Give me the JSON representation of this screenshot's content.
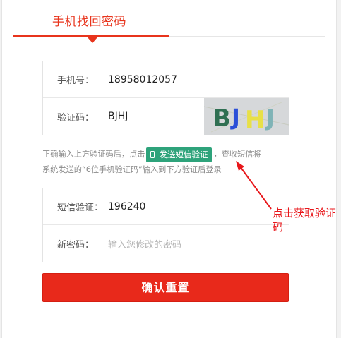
{
  "tab": {
    "title": "手机找回密码"
  },
  "phone": {
    "label": "手机号：",
    "value": "18958012057"
  },
  "captcha": {
    "label": "验证码：",
    "value": "BJHJ",
    "image_text": "BJHJ"
  },
  "hint": {
    "before": "正确输入上方验证码后，点击",
    "button": "发送短信验证",
    "after": "，查收短信将",
    "line2": "系统发送的“6位手机验证码”输入到下方验证后登录"
  },
  "sms": {
    "label": "短信验证：",
    "value": "196240"
  },
  "new_password": {
    "label": "新密码：",
    "placeholder": "输入您修改的密码"
  },
  "confirm": {
    "label": "确认重置"
  },
  "annotation": {
    "text": "点击获取验证码"
  },
  "colors": {
    "accent": "#e8341c",
    "sms_button": "#2ea37b",
    "annotation": "#e8171b"
  }
}
